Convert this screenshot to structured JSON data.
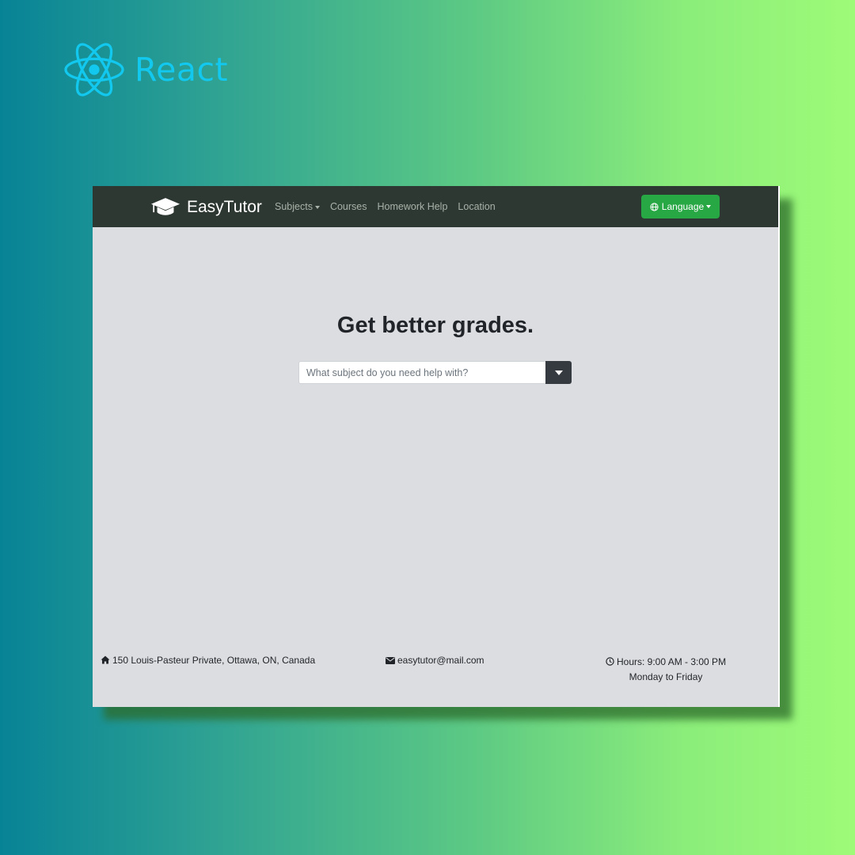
{
  "overlay": {
    "brand_text": "React",
    "logo_icon": "react-atom-icon",
    "brand_color": "#12c8ee"
  },
  "navbar": {
    "brand": "EasyTutor",
    "brand_icon": "graduation-cap-icon",
    "links": [
      {
        "label": "Subjects",
        "dropdown": true
      },
      {
        "label": "Courses"
      },
      {
        "label": "Homework Help"
      },
      {
        "label": "Location"
      }
    ],
    "language_button": {
      "label": "Language",
      "icon": "globe-icon",
      "color": "#28a745"
    }
  },
  "hero": {
    "title": "Get better grades.",
    "search_placeholder": "What subject do you need help with?"
  },
  "footer": {
    "address": "150 Louis-Pasteur Private, Ottawa, ON, Canada",
    "email": "easytutor@mail.com",
    "hours": "Hours: 9:00 AM - 3:00 PM",
    "days": "Monday to Friday"
  },
  "colors": {
    "navbar_bg": "#2e3832",
    "page_bg": "#dcdde1",
    "accent_green": "#28a745",
    "dark_button": "#343a40"
  }
}
